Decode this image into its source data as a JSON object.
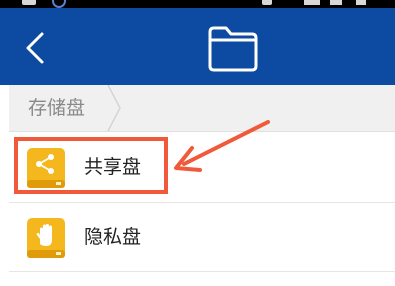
{
  "header": {
    "back_icon": "chevron-left-icon",
    "center_icon": "folder-icon",
    "background_color": "#0d4aa2"
  },
  "breadcrumb": {
    "items": [
      {
        "label": "存储盘"
      }
    ]
  },
  "list": {
    "items": [
      {
        "label": "共享盘",
        "icon": "share-drive-icon"
      },
      {
        "label": "隐私盘",
        "icon": "private-drive-icon"
      }
    ]
  },
  "annotation": {
    "highlight_color": "#f05a3a"
  }
}
